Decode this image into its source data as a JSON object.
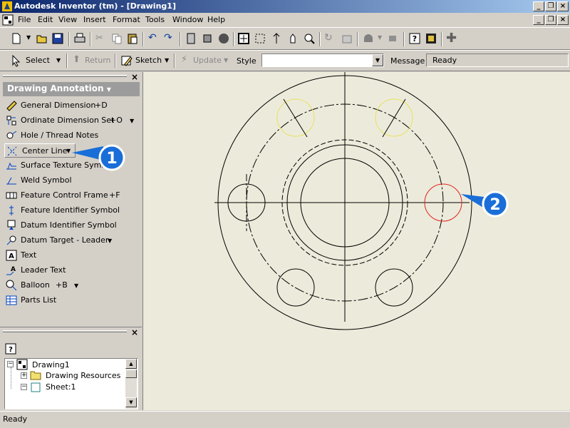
{
  "window": {
    "title": "Autodesk Inventor (tm) - [Drawing1]",
    "min_glyph": "_",
    "restore_glyph": "❐",
    "close_glyph": "×"
  },
  "menu": [
    "File",
    "Edit",
    "View",
    "Insert",
    "Format",
    "Tools",
    "Window",
    "Help"
  ],
  "command_bar": {
    "select": "Select",
    "return": "Return",
    "sketch": "Sketch",
    "update": "Update",
    "style_label": "Style",
    "style_value": "",
    "message_label": "Message",
    "message_value": "Ready"
  },
  "panel": {
    "title": "Drawing Annotation",
    "items": [
      {
        "label": "General Dimension",
        "shortcut": "+D",
        "icon": "general-dimension-icon"
      },
      {
        "label": "Ordinate Dimension Set",
        "shortcut": "+O",
        "icon": "ordinate-dimension-icon"
      },
      {
        "label": "Hole / Thread Notes",
        "shortcut": "",
        "icon": "hole-thread-icon"
      },
      {
        "label": "Center Line",
        "shortcut": "",
        "icon": "center-line-icon"
      },
      {
        "label": "Surface Texture Symbol",
        "shortcut": "",
        "icon": "surface-texture-icon"
      },
      {
        "label": "Weld Symbol",
        "shortcut": "",
        "icon": "weld-symbol-icon"
      },
      {
        "label": "Feature Control Frame",
        "shortcut": "+F",
        "icon": "feature-control-frame-icon"
      },
      {
        "label": "Feature Identifier Symbol",
        "shortcut": "",
        "icon": "feature-identifier-icon"
      },
      {
        "label": "Datum Identifier Symbol",
        "shortcut": "",
        "icon": "datum-identifier-icon"
      },
      {
        "label": "Datum Target - Leader",
        "shortcut": "",
        "icon": "datum-target-icon"
      },
      {
        "label": "Text",
        "shortcut": "",
        "icon": "text-icon"
      },
      {
        "label": "Leader Text",
        "shortcut": "",
        "icon": "leader-text-icon"
      },
      {
        "label": "Balloon",
        "shortcut": "+B",
        "icon": "balloon-icon"
      },
      {
        "label": "Parts List",
        "shortcut": "",
        "icon": "parts-list-icon"
      }
    ]
  },
  "browser": {
    "tree": [
      {
        "label": "Drawing1",
        "expander": "−"
      },
      {
        "label": "Drawing Resources",
        "expander": "+"
      },
      {
        "label": "Sheet:1",
        "expander": "−"
      }
    ]
  },
  "callouts": {
    "one": "1",
    "two": "2"
  },
  "status": {
    "text": "Ready"
  },
  "colors": {
    "highlight_yellow": "#e8e060",
    "highlight_red": "#e02020",
    "callout_blue": "#1a6ed8"
  }
}
